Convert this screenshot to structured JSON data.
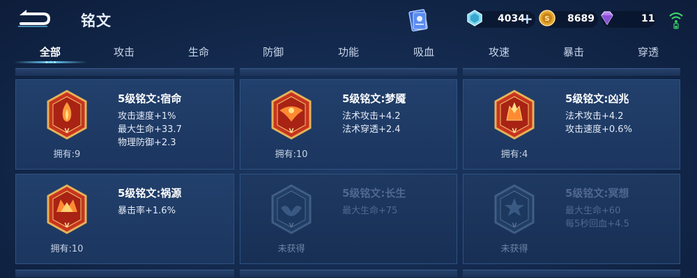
{
  "header": {
    "title": "铭文",
    "back_icon": "back-arrow-icon",
    "book_icon": "inscription-book-icon",
    "resources": [
      {
        "icon": "crystal-icon",
        "value": "4034",
        "has_plus": true
      },
      {
        "icon": "gold-coin-icon",
        "value": "8689"
      },
      {
        "icon": "diamond-icon",
        "value": "11"
      }
    ],
    "signal_icon": "wifi-signal-icon"
  },
  "tabs": [
    {
      "label": "全部",
      "active": true
    },
    {
      "label": "攻击"
    },
    {
      "label": "生命"
    },
    {
      "label": "防御"
    },
    {
      "label": "功能"
    },
    {
      "label": "吸血"
    },
    {
      "label": "攻速"
    },
    {
      "label": "暴击"
    },
    {
      "label": "穿透"
    }
  ],
  "cards": [
    {
      "name": "5级铭文:宿命",
      "stats": [
        "攻击速度+1%",
        "最大生命+33.7",
        "物理防御+2.3"
      ],
      "owned": "拥有:9",
      "locked": false,
      "icon": "fate-rune-icon"
    },
    {
      "name": "5级铭文:梦魇",
      "stats": [
        "法术攻击+4.2",
        "法术穿透+2.4"
      ],
      "owned": "拥有:10",
      "locked": false,
      "icon": "nightmare-rune-icon"
    },
    {
      "name": "5级铭文:凶兆",
      "stats": [
        "法术攻击+4.2",
        "攻击速度+0.6%"
      ],
      "owned": "拥有:4",
      "locked": false,
      "icon": "omen-rune-icon"
    },
    {
      "name": "5级铭文:祸源",
      "stats": [
        "暴击率+1.6%"
      ],
      "owned": "拥有:10",
      "locked": false,
      "icon": "calamity-rune-icon"
    },
    {
      "name": "5级铭文:长生",
      "stats": [
        "最大生命+75"
      ],
      "owned": "未获得",
      "locked": true,
      "icon": "longevity-rune-icon"
    },
    {
      "name": "5级铭文:冥想",
      "stats": [
        "最大生命+60",
        "每5秒回血+4.5"
      ],
      "owned": "未获得",
      "locked": true,
      "icon": "meditation-rune-icon"
    }
  ],
  "colors": {
    "accent": "#6fd4ff",
    "rune_gold": "#d9a441",
    "rune_red": "#c8341f",
    "background": "#142b50"
  }
}
